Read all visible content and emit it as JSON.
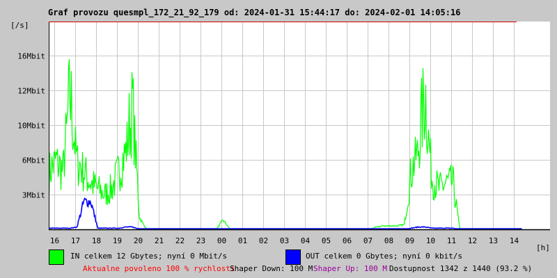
{
  "title": "Graf provozu quesmpl_172_21_92_179 od: 2024-01-31 15:44:17 do: 2024-02-01 14:05:16",
  "legend": {
    "in_label": "IN celkem 12 Gbytes; nyní 0 Mbit/s",
    "out_label": "OUT celkem 0 Gbytes; nyní 0 kbit/s",
    "in_color": "#00ff00",
    "out_color": "#0000ff"
  },
  "status": {
    "allowed": "Aktualne povoleno 100 % rychlosti",
    "shaper_down": "Shaper Down: 100 M",
    "shaper_up": "Shaper Up: 100 M",
    "availability": "Dostupnost 1342 z 1440 (93.2 %)",
    "allowed_color": "#ff0000",
    "shaper_up_color": "#990099"
  },
  "chart_data": {
    "type": "line",
    "title": "Graf provozu quesmpl_172_21_92_179 od: 2024-01-31 15:44:17 do: 2024-02-01 14:05:16",
    "ylabel": "[/s]",
    "xlabel": "[h]",
    "y_ticks": [
      {
        "label": "3Mbit",
        "value": 3
      },
      {
        "label": "6Mbit",
        "value": 6
      },
      {
        "label": "10Mbit",
        "value": 10
      },
      {
        "label": "12Mbit",
        "value": 12
      },
      {
        "label": "16Mbit",
        "value": 16
      }
    ],
    "x_ticks": [
      "16",
      "17",
      "18",
      "19",
      "20",
      "21",
      "22",
      "23",
      "00",
      "01",
      "02",
      "03",
      "04",
      "05",
      "06",
      "07",
      "08",
      "09",
      "10",
      "11",
      "12",
      "13",
      "14"
    ],
    "x_start": "15:44",
    "sample_minutes": 20,
    "grid": true,
    "series": [
      {
        "name": "IN",
        "color": "#00ff00",
        "values": [
          5,
          6,
          5,
          12.5,
          6,
          5,
          4,
          3.5,
          3,
          3.5,
          5,
          7,
          11,
          1,
          0,
          0,
          0,
          0,
          0,
          0,
          0,
          0,
          0,
          0,
          0,
          0.8,
          0,
          0,
          0,
          0,
          0,
          0,
          0,
          0,
          0,
          0,
          0,
          0,
          0,
          0,
          0,
          0,
          0,
          0,
          0,
          0,
          0,
          0.2,
          0.3,
          0.3,
          0.3,
          0.4,
          5,
          7,
          12.5,
          4.5,
          3.5,
          4,
          4,
          0,
          0,
          0,
          0,
          0,
          0,
          0,
          0,
          0
        ]
      },
      {
        "name": "OUT",
        "color": "#0000ff",
        "values": [
          0.1,
          0.1,
          0.1,
          0.1,
          0.2,
          2.4,
          2.4,
          0.1,
          0.1,
          0.1,
          0.1,
          0.2,
          0.2,
          0,
          0,
          0,
          0,
          0,
          0,
          0,
          0,
          0,
          0,
          0,
          0,
          0,
          0,
          0,
          0,
          0,
          0,
          0,
          0,
          0,
          0,
          0,
          0,
          0,
          0,
          0,
          0,
          0,
          0,
          0,
          0,
          0,
          0,
          0,
          0,
          0,
          0,
          0,
          0.1,
          0.2,
          0.2,
          0.1,
          0.1,
          0.1,
          0.1,
          0,
          0,
          0,
          0,
          0,
          0,
          0,
          0,
          0
        ]
      }
    ]
  }
}
